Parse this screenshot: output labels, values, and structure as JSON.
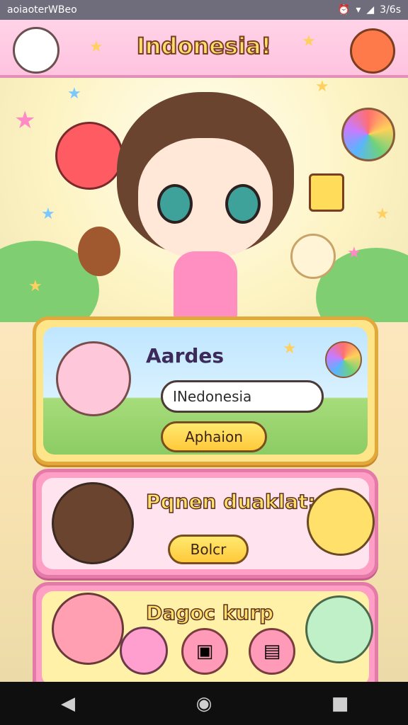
{
  "status_bar": {
    "left_text": "aoiaoterWBeo",
    "right_text": "3/6s"
  },
  "header": {
    "title": "Indonesia!"
  },
  "panel_search": {
    "title": "Aardes",
    "search_value": "INedonesia",
    "button_label": "Aphaion"
  },
  "panel_middle": {
    "title": "Pqnen duaklat:",
    "button_label": "Bolcr"
  },
  "panel_bottom": {
    "title": "Dagoc kurp"
  },
  "colors": {
    "header_bg": "#ffc3df",
    "panel_border": "#e2a93a",
    "panel_pink": "#ff9fc6",
    "button_yellow": "#ffc93b"
  },
  "icons": {
    "nav_back": "back-triangle",
    "nav_home": "home-circle",
    "nav_recent": "recent-square"
  }
}
